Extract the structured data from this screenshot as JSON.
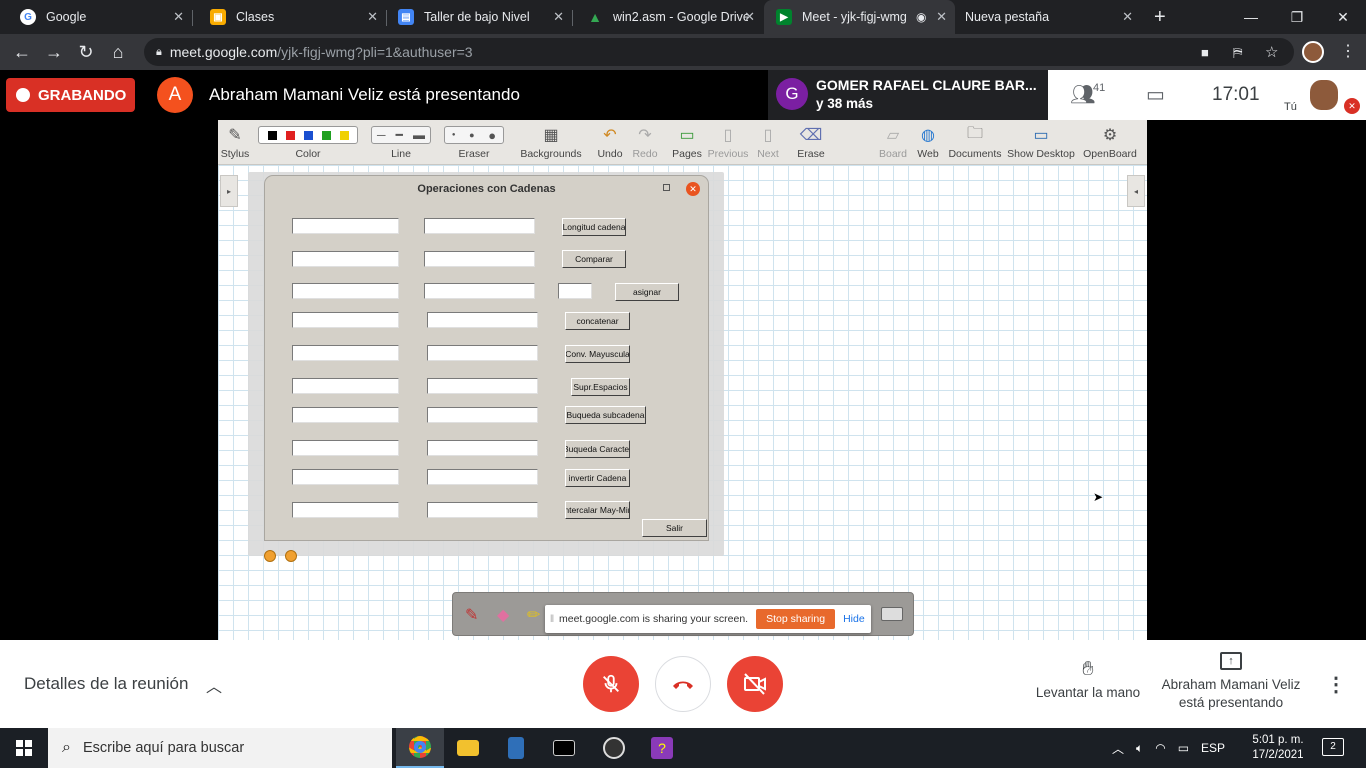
{
  "browser": {
    "tabs": [
      {
        "label": "Google",
        "icon": "google-icon",
        "color": "#4285f4"
      },
      {
        "label": "Clases",
        "icon": "classroom-icon",
        "color": "#f9ab00"
      },
      {
        "label": "Taller de bajo Nivel",
        "icon": "document-icon",
        "color": "#4285f4"
      },
      {
        "label": "win2.asm - Google Drive",
        "icon": "drive-icon",
        "color": "#34a853"
      },
      {
        "label": "Meet - yjk-figj-wmg",
        "icon": "meet-icon",
        "color": "#00832d"
      },
      {
        "label": "Nueva pestaña",
        "icon": "",
        "color": ""
      }
    ],
    "url_host": "meet.google.com",
    "url_path": "/yjk-figj-wmg?pli=1&authuser=3"
  },
  "meet": {
    "recording_label": "GRABANDO",
    "presenter_initial": "A",
    "presenting_title": "Abraham Mamani Veliz está presentando",
    "participant_initial": "G",
    "participant_name": "GOMER RAFAEL CLAURE BAR...",
    "participant_more": "y 38 más",
    "people_count": "41",
    "clock": "17:01",
    "self_label": "Tú",
    "details_label": "Detalles de la reunión",
    "raise_hand_label": "Levantar la mano",
    "present_status": "Abraham Mamani Veliz está presentando"
  },
  "openboard": {
    "tools": [
      {
        "label": "Stylus",
        "icon": "stylus-icon"
      },
      {
        "label": "Color",
        "icon": "color-palette-icon"
      },
      {
        "label": "Line",
        "icon": "line-width-icon"
      },
      {
        "label": "Eraser",
        "icon": "eraser-size-icon"
      },
      {
        "label": "Backgrounds",
        "icon": "backgrounds-icon"
      },
      {
        "label": "Undo",
        "icon": "undo-icon"
      },
      {
        "label": "Redo",
        "icon": "redo-icon"
      },
      {
        "label": "Pages",
        "icon": "pages-icon"
      },
      {
        "label": "Previous",
        "icon": "previous-icon"
      },
      {
        "label": "Next",
        "icon": "next-icon"
      },
      {
        "label": "Erase",
        "icon": "erase-icon"
      },
      {
        "label": "Board",
        "icon": "board-icon"
      },
      {
        "label": "Web",
        "icon": "web-globe-icon"
      },
      {
        "label": "Documents",
        "icon": "documents-folder-icon"
      },
      {
        "label": "Show Desktop",
        "icon": "show-desktop-icon"
      },
      {
        "label": "OpenBoard",
        "icon": "openboard-gear-icon"
      }
    ],
    "colors": [
      "#000000",
      "#e02020",
      "#1a4fd0",
      "#20a020",
      "#f0d000"
    ]
  },
  "app_window": {
    "title": "Operaciones con Cadenas",
    "buttons": [
      "Longitud cadena",
      "Comparar",
      "asignar",
      "concatenar",
      "Conv. Mayuscula",
      "Supr.Espacios",
      "Buqueda subcadena",
      "Buqueda Caracter",
      "invertir Cadena",
      "intercalar May-Min",
      "Salir"
    ]
  },
  "share_notice": {
    "message": "meet.google.com is sharing your screen.",
    "stop_label": "Stop sharing",
    "hide_label": "Hide"
  },
  "taskbar": {
    "search_placeholder": "Escribe aquí para buscar",
    "language": "ESP",
    "time": "5:01 p. m.",
    "date": "17/2/2021",
    "notifications": "2"
  }
}
